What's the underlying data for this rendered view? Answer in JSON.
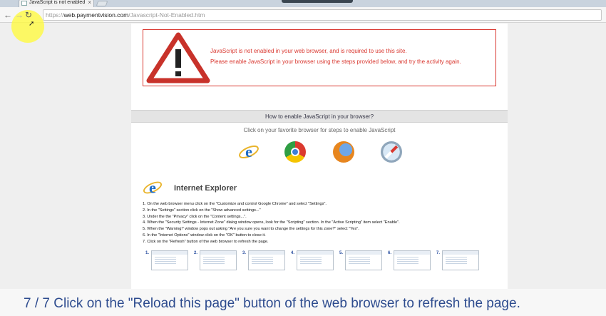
{
  "browser": {
    "tab_title": "JavaScript is not enabled",
    "tab_close": "×",
    "url_scheme": "https://",
    "url_host": "web.paymentvision.com",
    "url_path": "/Javascript-Not-Enabled.htm"
  },
  "toolbar": {
    "back_icon": "←",
    "forward_icon": "→",
    "reload_icon": "↻"
  },
  "warning": {
    "line1": "JavaScript is not enabled in your web browser, and is required to use this site.",
    "line2": "Please enable JavaScript in your browser using the steps provided below, and try the activity again."
  },
  "how_to": {
    "header": "How to enable JavaScript in your browser?",
    "subtitle": "Click on your favorite browser for steps to enable JavaScript"
  },
  "browsers": [
    "internet-explorer",
    "chrome",
    "firefox",
    "safari"
  ],
  "ie_section": {
    "title": "Internet Explorer",
    "steps": [
      "1. On the web browser menu click on the \"Customize and control Google Chrome\" and select \"Settings\".",
      "2. In the \"Settings\" section click on the \"Show advanced settings...\"",
      "3. Under the the \"Privacy\" click on the \"Content settings...\".",
      "4. When the \"Security Settings - Internet Zone\" dialog window opens, look for the \"Scripting\" section. In the \"Active Scripting\" item select \"Enable\".",
      "5. When the \"Warning!\" window pops out asking \"Are you sure you want to change the settings for this zone?\" select \"Yes\".",
      "6. In the \"Internet Options\" window click on the \"OK\" button to close it.",
      "7. Click on the \"Refresh\" button of the web browser to refresh the page."
    ],
    "thumb_labels": [
      "1.",
      "2.",
      "3.",
      "4.",
      "5.",
      "6.",
      "7."
    ]
  },
  "caption": {
    "text": "7 / 7   Click on the \"Reload this page\" button of the web browser to refresh the page."
  }
}
